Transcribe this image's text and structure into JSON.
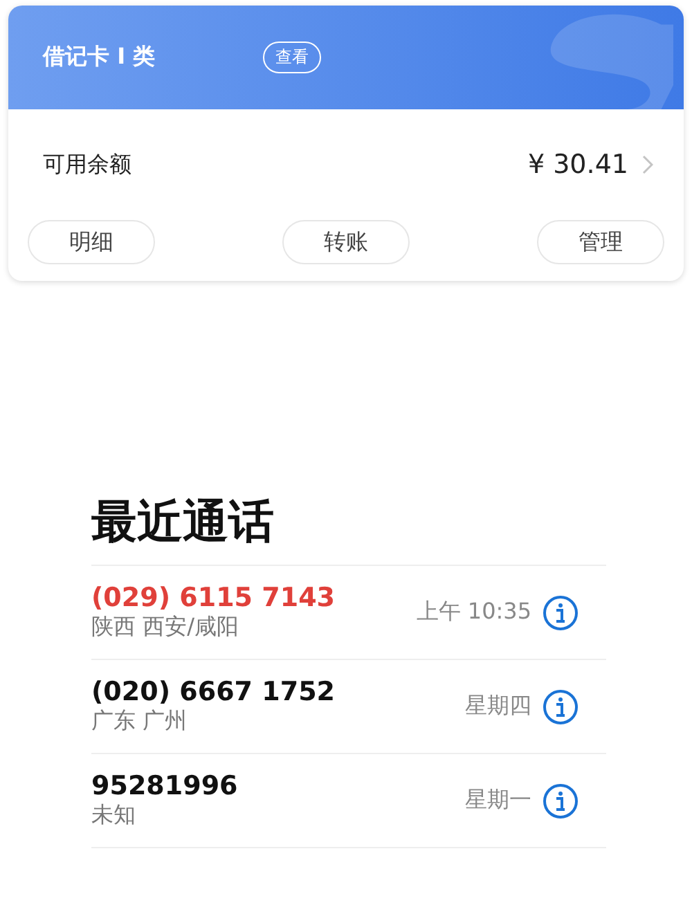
{
  "card": {
    "title": "借记卡 I 类",
    "view_button": "查看",
    "balance_label": "可用余额",
    "balance": "¥ 30.41",
    "actions": [
      "明细",
      "转账",
      "管理"
    ]
  },
  "recents": {
    "title": "最近通话",
    "calls": [
      {
        "number": "(029) 6115 7143",
        "location": "陕西 西安/咸阳",
        "time": "上午 10:35",
        "missed": true
      },
      {
        "number": "(020) 6667 1752",
        "location": "广东 广州",
        "time": "星期四",
        "missed": false
      },
      {
        "number": "95281996",
        "location": "未知",
        "time": "星期一",
        "missed": false
      }
    ]
  }
}
